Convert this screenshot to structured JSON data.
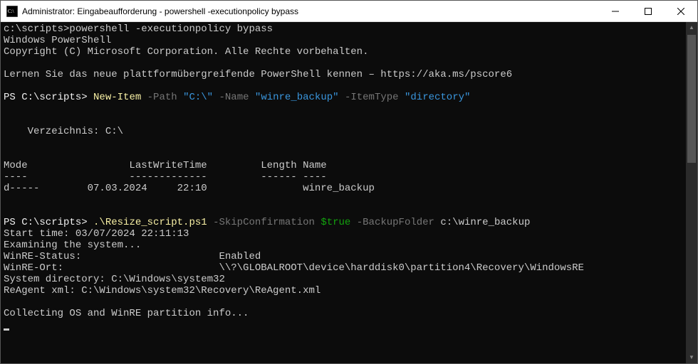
{
  "window": {
    "title": "Administrator: Eingabeaufforderung - powershell  -executionpolicy bypass"
  },
  "term": {
    "cmd_prompt": "c:\\scripts>",
    "cmd_line": "powershell -executionpolicy bypass",
    "psline1": "Windows PowerShell",
    "psline2": "Copyright (C) Microsoft Corporation. Alle Rechte vorbehalten.",
    "psline3": "Lernen Sie das neue plattformübergreifende PowerShell kennen – https://aka.ms/pscore6",
    "ps_prompt1": "PS C:\\scripts> ",
    "ni_cmdlet": "New-Item",
    "ni_sp1": " ",
    "ni_path_p": "-Path",
    "ni_sp2": " ",
    "ni_path_v": "\"C:\\\"",
    "ni_sp3": " ",
    "ni_name_p": "-Name",
    "ni_sp4": " ",
    "ni_name_v": "\"winre_backup\"",
    "ni_sp5": " ",
    "ni_it_p": "-ItemType",
    "ni_sp6": " ",
    "ni_it_v": "\"directory\"",
    "dirheader": "    Verzeichnis: C:\\",
    "tbl_hdr": "Mode                 LastWriteTime         Length Name",
    "tbl_sep": "----                 -------------         ------ ----",
    "tbl_row": "d-----        07.03.2024     22:10                winre_backup",
    "ps_prompt2": "PS C:\\scripts> ",
    "rs_script": ".\\Resize_script.ps1",
    "rs_sp1": " ",
    "rs_skip_p": "-SkipConfirmation",
    "rs_sp2": " ",
    "rs_true": "$true",
    "rs_sp3": " ",
    "rs_bf_p": "-BackupFolder",
    "rs_sp4": " ",
    "rs_bf_v": "c:\\winre_backup",
    "out1": "Start time: 03/07/2024 22:11:13",
    "out2": "Examining the system...",
    "out3": "WinRE-Status:                       Enabled",
    "out4": "WinRE-Ort:                          \\\\?\\GLOBALROOT\\device\\harddisk0\\partition4\\Recovery\\WindowsRE",
    "out5": "System directory: C:\\Windows\\system32",
    "out6": "ReAgent xml: C:\\Windows\\system32\\Recovery\\ReAgent.xml",
    "out7": "Collecting OS and WinRE partition info..."
  }
}
